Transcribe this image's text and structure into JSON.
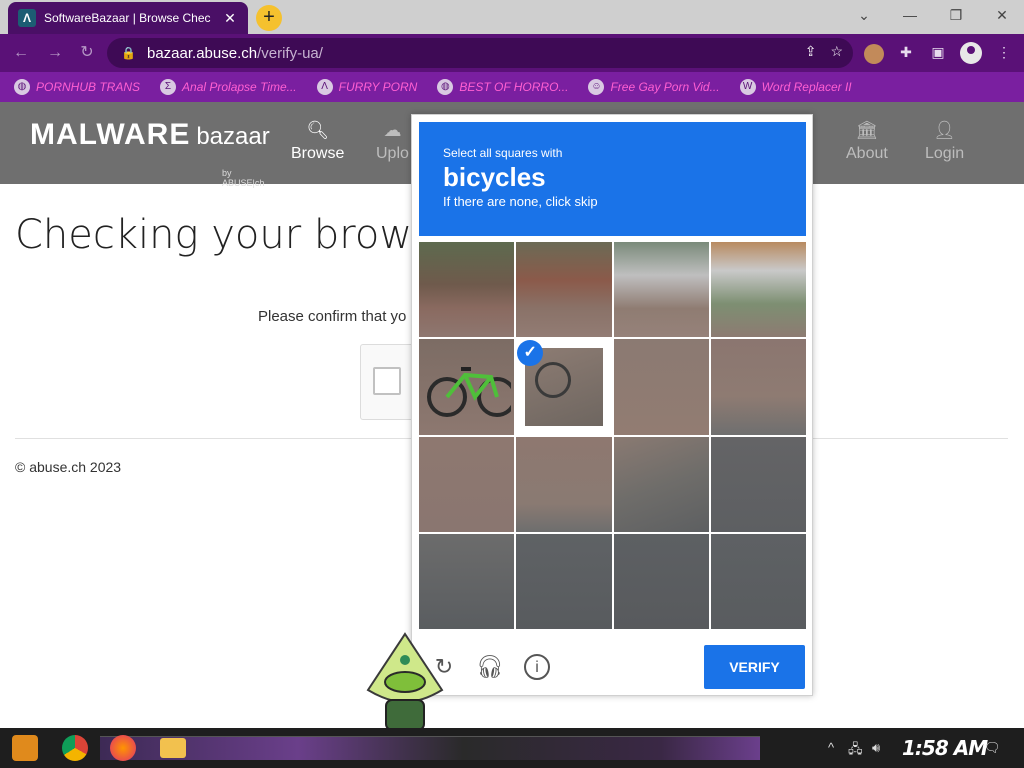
{
  "browser": {
    "tab_title": "SoftwareBazaar | Browse Chec",
    "tab_favicon": "Λ",
    "new_tab_label": "+",
    "url_host": "bazaar.abuse.ch",
    "url_path": "/verify-ua/"
  },
  "bookmarks": [
    {
      "label": "PORNHUB TRANS",
      "icon": "globe-icon"
    },
    {
      "label": "Anal Prolapse Time...",
      "icon": "bracket-icon"
    },
    {
      "label": "FURRY PORN",
      "icon": "lambda-icon"
    },
    {
      "label": "BEST OF HORRO...",
      "icon": "globe-icon"
    },
    {
      "label": "Free Gay Porn Vid...",
      "icon": "face-icon"
    },
    {
      "label": "Word Replacer II",
      "icon": "wr-icon"
    }
  ],
  "site": {
    "logo_word1": "MALWARE",
    "logo_word2": "bazaar",
    "logo_by": "by ABUSE|ch",
    "nav": {
      "browse": "Browse",
      "upload": "Uplo",
      "about": "About",
      "login": "Login"
    },
    "page_title": "Checking your browser",
    "confirm_text": "Please confirm that yo",
    "copyright": "© abuse.ch 2023"
  },
  "challenge": {
    "instruction": "Select all squares with",
    "target": "bicycles",
    "hint": "If there are none, click skip",
    "verify_label": "VERIFY",
    "selected_tiles": [
      5
    ]
  },
  "taskbar": {
    "clock": "1:58 AM"
  }
}
